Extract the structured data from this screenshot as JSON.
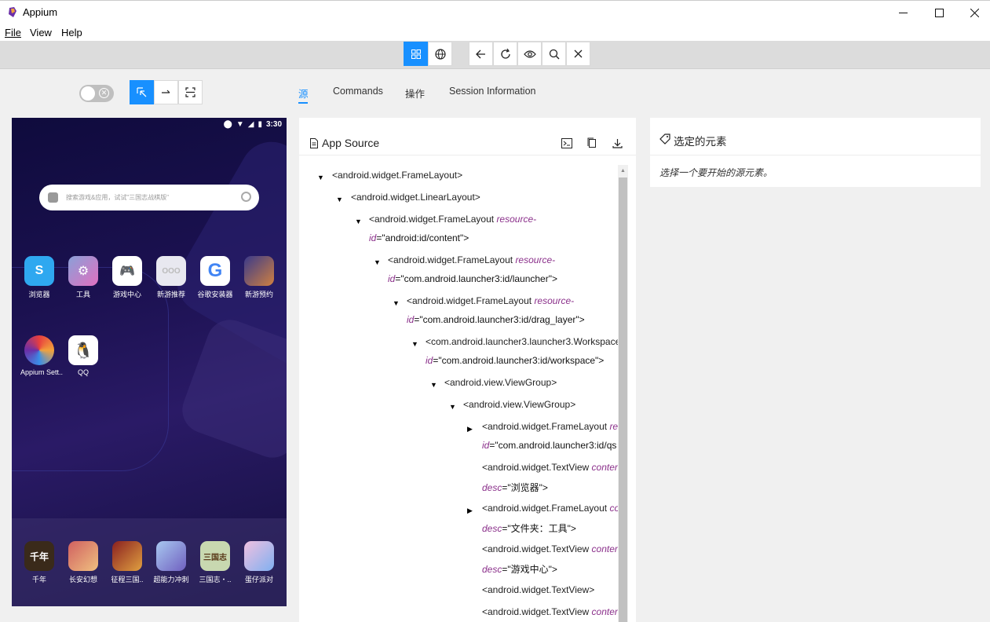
{
  "window": {
    "title": "Appium",
    "minimize": "—",
    "maximize": "☐",
    "close": "✕"
  },
  "menu": {
    "file": "File",
    "view": "View",
    "help": "Help"
  },
  "tabs": {
    "source": "源",
    "commands": "Commands",
    "actions": "操作",
    "session": "Session Information"
  },
  "phone": {
    "status": {
      "time": "3:30"
    },
    "search_placeholder": "搜索游戏&应用，试试\"三国志战棋版\"",
    "apps_row1": [
      {
        "label": "浏览器",
        "icon": "browser-icon",
        "color": "#2fa8f0"
      },
      {
        "label": "工具",
        "icon": "tools-folder-icon",
        "color": "#8aa0d8"
      },
      {
        "label": "游戏中心",
        "icon": "game-center-icon",
        "color": "#ffffff"
      },
      {
        "label": "新游推荐",
        "icon": "new-games-icon",
        "color": "#e8e8f0"
      },
      {
        "label": "谷歌安装器",
        "icon": "google-installer-icon",
        "color": "#ffffff"
      },
      {
        "label": "新游预约",
        "icon": "game-reservation-icon",
        "color": "#5a6ab8"
      }
    ],
    "apps_row2": [
      {
        "label": "Appium Sett..",
        "icon": "appium-settings-icon",
        "color": "#ffffff"
      },
      {
        "label": "QQ",
        "icon": "qq-icon",
        "color": "#ffffff"
      }
    ],
    "dock": [
      {
        "label": "千年",
        "icon": "qiannian-icon",
        "color": "#3a2a1a"
      },
      {
        "label": "长安幻想",
        "icon": "changan-icon",
        "color": "#d06060"
      },
      {
        "label": "征程三国..",
        "icon": "zhengcheng-icon",
        "color": "#8a2020"
      },
      {
        "label": "超能力冲刺",
        "icon": "superpower-icon",
        "color": "#a8c8f0"
      },
      {
        "label": "三国志・..",
        "icon": "sanguozhi-icon",
        "color": "#c8d8b0"
      },
      {
        "label": "蛋仔派对",
        "icon": "eggy-party-icon",
        "color": "#f0c0e0"
      }
    ]
  },
  "source": {
    "title": "App Source",
    "rows": [
      {
        "tri": "▼",
        "tag": "<android.widget.FrameLayout>",
        "attr": "",
        "rest": ""
      },
      {
        "tri": "▼",
        "tag": "<android.widget.LinearLayout>",
        "attr": "",
        "rest": ""
      },
      {
        "tri": "▼",
        "tag": "<android.widget.FrameLayout ",
        "attr": "resource-",
        "rest": ""
      },
      {
        "tri": "",
        "tag": "",
        "attr": "id",
        "rest": "=\"android:id/content\">"
      },
      {
        "tri": "▼",
        "tag": "<android.widget.FrameLayout ",
        "attr": "resource-",
        "rest": ""
      },
      {
        "tri": "",
        "tag": "",
        "attr": "id",
        "rest": "=\"com.android.launcher3:id/launcher\">"
      },
      {
        "tri": "▼",
        "tag": "<android.widget.FrameLayout ",
        "attr": "resource-",
        "rest": ""
      },
      {
        "tri": "",
        "tag": "",
        "attr": "id",
        "rest": "=\"com.android.launcher3:id/drag_layer\">"
      },
      {
        "tri": "▼",
        "tag": "<com.android.launcher3.launcher3.Workspace",
        "attr": "",
        "rest": ""
      },
      {
        "tri": "",
        "tag": "",
        "attr": "id",
        "rest": "=\"com.android.launcher3:id/workspace\">"
      },
      {
        "tri": "▼",
        "tag": "<android.view.ViewGroup>",
        "attr": "",
        "rest": ""
      },
      {
        "tri": "▼",
        "tag": "<android.view.ViewGroup>",
        "attr": "",
        "rest": ""
      },
      {
        "tri": "▶",
        "tag": "<android.widget.FrameLayout ",
        "attr": "re",
        "rest": ""
      },
      {
        "tri": "",
        "tag": "",
        "attr": "id",
        "rest": "=\"com.android.launcher3:id/qs"
      },
      {
        "tri": "",
        "tag": "<android.widget.TextView ",
        "attr": "conter",
        "rest": ""
      },
      {
        "tri": "",
        "tag": "",
        "attr": "desc",
        "rest": "=\"浏览器\">"
      },
      {
        "tri": "▶",
        "tag": "<android.widget.FrameLayout ",
        "attr": "co",
        "rest": ""
      },
      {
        "tri": "",
        "tag": "",
        "attr": "desc",
        "rest": "=\"文件夹：工具\">"
      },
      {
        "tri": "",
        "tag": "<android.widget.TextView ",
        "attr": "conter",
        "rest": ""
      },
      {
        "tri": "",
        "tag": "",
        "attr": "desc",
        "rest": "=\"游戏中心\">"
      },
      {
        "tri": "",
        "tag": "<android.widget.TextView>",
        "attr": "",
        "rest": ""
      },
      {
        "tri": "",
        "tag": "<android.widget.TextView ",
        "attr": "conter",
        "rest": ""
      }
    ]
  },
  "selected": {
    "title": "选定的元素",
    "hint": "选择一个要开始的源元素。"
  }
}
